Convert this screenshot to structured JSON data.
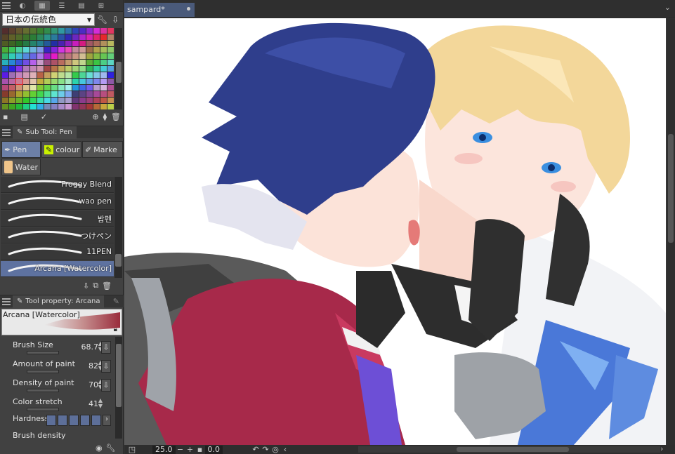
{
  "app": {
    "document_tab": "sampard*"
  },
  "colorset": {
    "selected": "日本の伝統色"
  },
  "subtool_panel": {
    "title": "Sub Tool: Pen",
    "groups": [
      "Pen",
      "colour",
      "Marke",
      "Water"
    ],
    "brushes": [
      {
        "name": "Froggy Blend"
      },
      {
        "name": "wao pen"
      },
      {
        "name": "밥펜"
      },
      {
        "name": "つけペン"
      },
      {
        "name": "11PEN"
      },
      {
        "name": "Arcana [Watercolor]"
      }
    ],
    "selected_brush": "Arcana [Watercolor]"
  },
  "tool_property": {
    "title": "Tool property: Arcana",
    "brush_name": "Arcana [Watercolor]",
    "properties": [
      {
        "label": "Brush Size",
        "value": "68.7"
      },
      {
        "label": "Amount of paint",
        "value": "82"
      },
      {
        "label": "Density of paint",
        "value": "70"
      },
      {
        "label": "Color stretch",
        "value": "41"
      },
      {
        "label": "Hardness",
        "value": ""
      },
      {
        "label": "Brush density",
        "value": ""
      }
    ]
  },
  "status": {
    "zoom": "25.0",
    "angle": "0.0"
  },
  "colors": {
    "panel": "#414141",
    "selection": "#5e72a0",
    "canvas_bg": "#ffffff"
  }
}
